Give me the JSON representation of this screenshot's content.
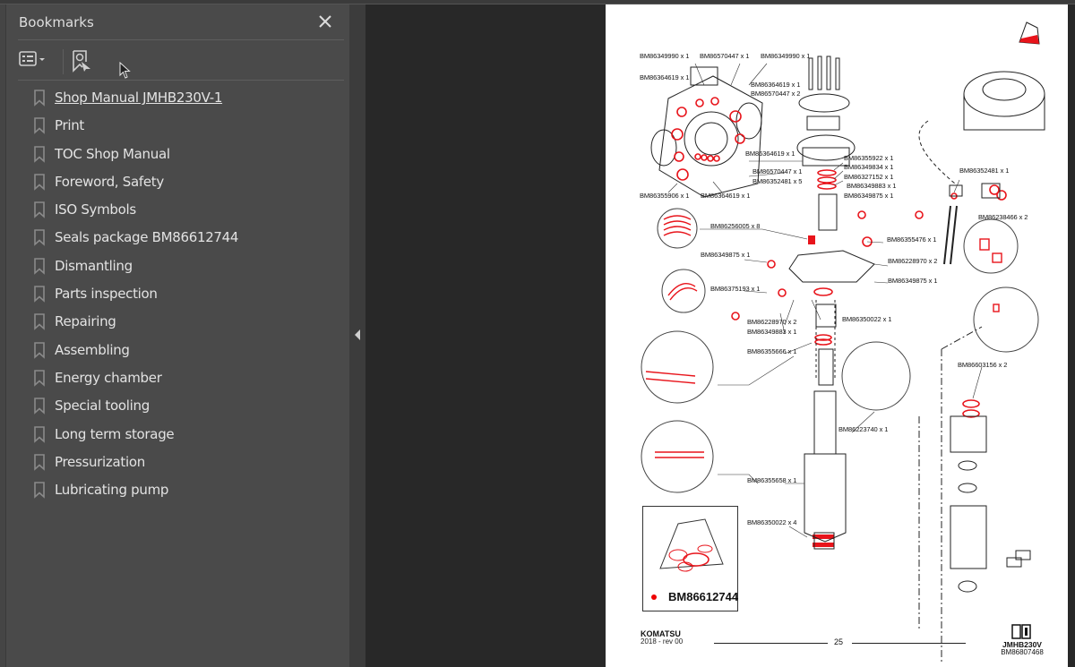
{
  "bookmarks_panel": {
    "title": "Bookmarks",
    "close_icon": "close-icon",
    "toolbar": {
      "options_icon": "list-options-icon",
      "find_icon": "find-current-bookmark-icon"
    },
    "items": [
      {
        "label": "Shop Manual JMHB230V-1",
        "active": true
      },
      {
        "label": "Print"
      },
      {
        "label": "TOC Shop Manual"
      },
      {
        "label": "Foreword, Safety"
      },
      {
        "label": "ISO Symbols"
      },
      {
        "label": "Seals package BM86612744"
      },
      {
        "label": "Dismantling"
      },
      {
        "label": "Parts inspection"
      },
      {
        "label": "Repairing"
      },
      {
        "label": "Assembling"
      },
      {
        "label": "Energy chamber"
      },
      {
        "label": "Special tooling"
      },
      {
        "label": "Long term storage"
      },
      {
        "label": "Pressurization"
      },
      {
        "label": "Lubricating pump"
      }
    ]
  },
  "document_page": {
    "callouts": [
      "BM86349990 x 1",
      "BM86570447 x 1",
      "BM86349990 x 1",
      "BM86364619 x 1",
      "BM86364619 x 1",
      "BM86570447 x 2",
      "BM86364619 x 1",
      "BM86570447 x 1",
      "BM86352481 x 5",
      "BM86355906 x 1",
      "BM86364619 x 1",
      "BM86355922 x 1",
      "BM86349834 x 1",
      "BM86327152 x 1",
      "BM86349883 x 1",
      "BM86349875 x 1",
      "BM86352481 x 1",
      "BM86238466 x 2",
      "BM86256005 x 8",
      "BM86355476 x 1",
      "BM86349875 x 1",
      "BM86228970 x 2",
      "BM86349875 x 1",
      "BM86375193 x 1",
      "BM86228970 x 2",
      "BM86349883 x 1",
      "BM86350022 x 1",
      "BM86355666 x 1",
      "BM86603156 x 2",
      "BM86223740 x 1",
      "BM86355658 x 1",
      "BM86350022 x 4"
    ],
    "kit_label": "BM86612744",
    "footer": {
      "brand": "KOMATSU",
      "revision": "2018 -   rev 00",
      "page_number": "25",
      "model": "JMHB230V",
      "doc_code": "BM86807468"
    },
    "accent_color": "#e8141b"
  }
}
